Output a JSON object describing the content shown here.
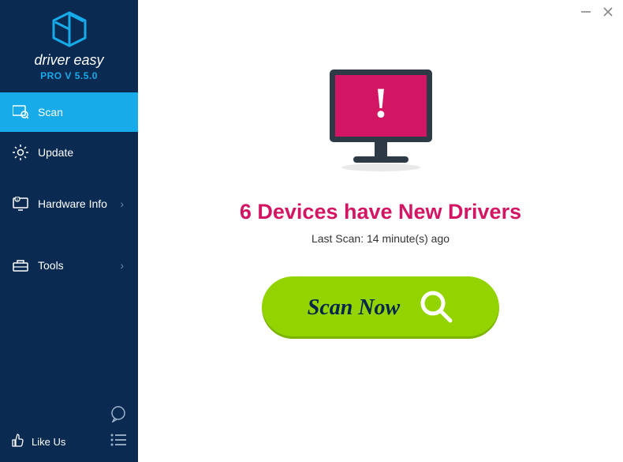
{
  "brand": {
    "name": "driver easy",
    "version": "PRO V 5.5.0"
  },
  "sidebar": {
    "items": [
      {
        "label": "Scan"
      },
      {
        "label": "Update"
      },
      {
        "label": "Hardware Info"
      },
      {
        "label": "Tools"
      }
    ],
    "like": "Like Us"
  },
  "main": {
    "headline": "6 Devices have New Drivers",
    "last_scan": "Last Scan: 14 minute(s) ago",
    "scan_button": "Scan Now"
  }
}
